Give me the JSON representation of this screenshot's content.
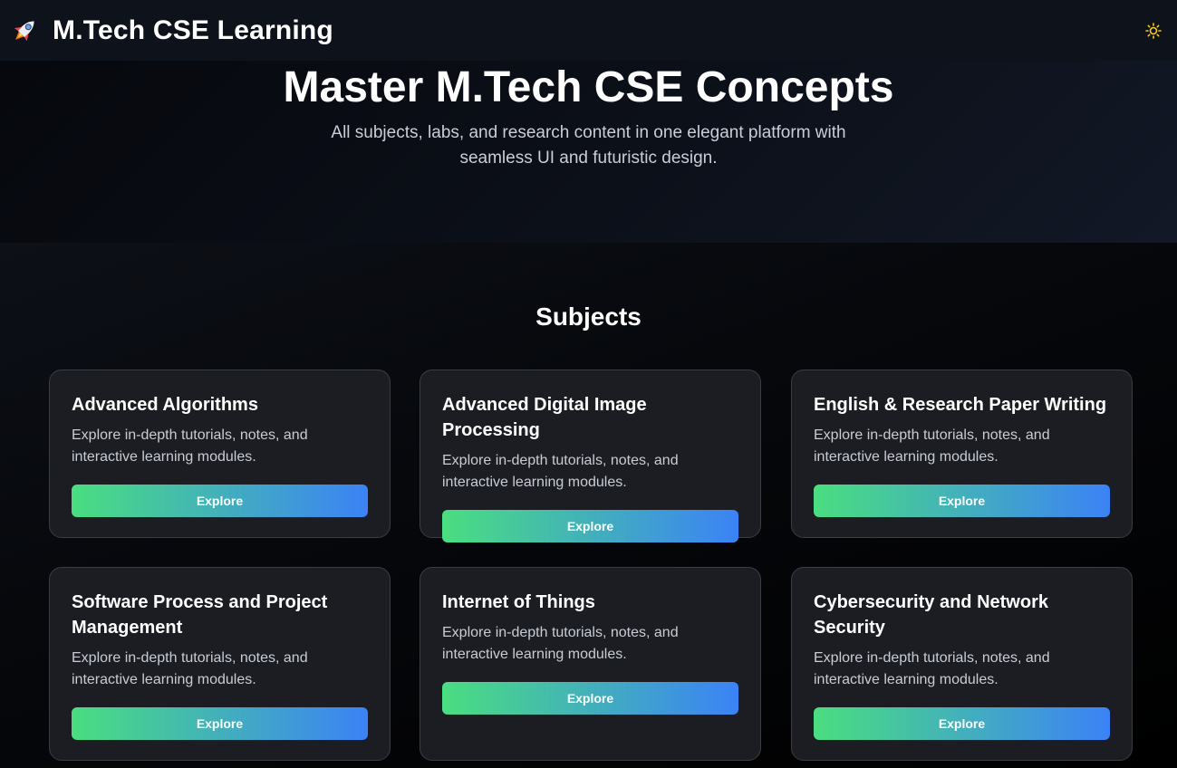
{
  "header": {
    "logo_icon": "rocket-icon",
    "title": "M.Tech CSE Learning",
    "theme_toggle_icon": "sun-icon",
    "accent_color": "#facc15"
  },
  "hero": {
    "title": "Master M.Tech CSE Concepts",
    "subtitle": "All subjects, labs, and research content in one elegant platform with seamless UI and futuristic design."
  },
  "subjects": {
    "heading": "Subjects",
    "button_gradient": [
      "#4ade80",
      "#3b82f6"
    ],
    "cards": [
      {
        "title": "Advanced Algorithms",
        "description": "Explore in-depth tutorials, notes, and interactive learning modules.",
        "button": "Explore"
      },
      {
        "title": "Advanced Digital Image Processing",
        "description": "Explore in-depth tutorials, notes, and interactive learning modules.",
        "button": "Explore"
      },
      {
        "title": "English & Research Paper Writing",
        "description": "Explore in-depth tutorials, notes, and interactive learning modules.",
        "button": "Explore"
      },
      {
        "title": "Software Process and Project Management",
        "description": "Explore in-depth tutorials, notes, and interactive learning modules.",
        "button": "Explore"
      },
      {
        "title": "Internet of Things",
        "description": "Explore in-depth tutorials, notes, and interactive learning modules.",
        "button": "Explore"
      },
      {
        "title": "Cybersecurity and Network Security",
        "description": "Explore in-depth tutorials, notes, and interactive learning modules.",
        "button": "Explore"
      }
    ]
  }
}
